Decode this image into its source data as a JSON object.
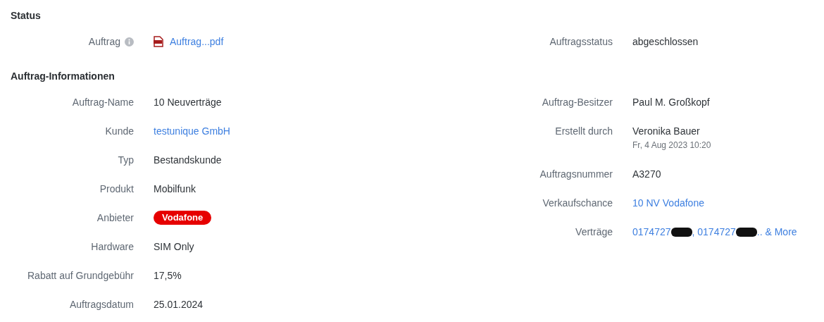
{
  "sections": [
    {
      "title": "Status",
      "left": [
        {
          "label": "Auftrag",
          "info": true,
          "value": {
            "kind": "file",
            "text": "Auftrag...pdf"
          }
        }
      ],
      "right": [
        {
          "label": "Auftragsstatus",
          "info": false,
          "value": {
            "kind": "text",
            "text": "abgeschlossen"
          }
        }
      ]
    },
    {
      "title": "Auftrag-Informationen",
      "left": [
        {
          "label": "Auftrag-Name",
          "info": false,
          "value": {
            "kind": "text",
            "text": "10 Neuverträge"
          }
        },
        {
          "label": "Kunde",
          "info": false,
          "value": {
            "kind": "link",
            "text": "testunique GmbH"
          }
        },
        {
          "label": "Typ",
          "info": false,
          "value": {
            "kind": "text",
            "text": "Bestandskunde"
          }
        },
        {
          "label": "Produkt",
          "info": false,
          "value": {
            "kind": "text",
            "text": "Mobilfunk"
          }
        },
        {
          "label": "Anbieter",
          "info": false,
          "value": {
            "kind": "badge",
            "text": "Vodafone",
            "color": "#e60000"
          }
        },
        {
          "label": "Hardware",
          "info": false,
          "value": {
            "kind": "text",
            "text": "SIM Only"
          }
        },
        {
          "label": "Rabatt auf Grundgebühr",
          "info": false,
          "value": {
            "kind": "text",
            "text": "17,5%"
          }
        },
        {
          "label": "Auftragsdatum",
          "info": false,
          "value": {
            "kind": "text",
            "text": "25.01.2024"
          }
        }
      ],
      "right": [
        {
          "label": "Auftrag-Besitzer",
          "info": false,
          "value": {
            "kind": "text",
            "text": "Paul M. Großkopf"
          }
        },
        {
          "label": "Erstellt durch",
          "info": false,
          "value": {
            "kind": "text",
            "text": "Veronika Bauer",
            "sub": "Fr, 4 Aug 2023 10:20"
          }
        },
        {
          "label": "Auftragsnummer",
          "info": false,
          "value": {
            "kind": "text",
            "text": "A3270"
          }
        },
        {
          "label": "Verkaufschance",
          "info": false,
          "value": {
            "kind": "link",
            "text": "10 NV Vodafone"
          }
        },
        {
          "label": "Verträge",
          "info": false,
          "value": {
            "kind": "parts",
            "parts": [
              {
                "kind": "link",
                "text": "0174727"
              },
              {
                "kind": "redaction"
              },
              {
                "kind": "link",
                "text": ", 0174727"
              },
              {
                "kind": "redaction"
              },
              {
                "kind": "link",
                "text": ".. & More"
              }
            ]
          }
        }
      ]
    }
  ]
}
